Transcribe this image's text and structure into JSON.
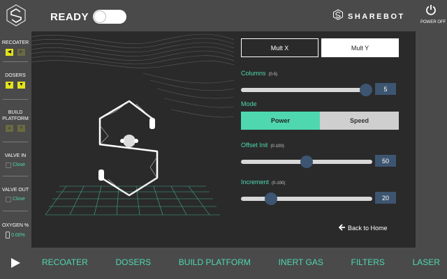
{
  "header": {
    "status_label": "READY",
    "brand_name": "SHAREBOT",
    "power_label": "POWER OFF"
  },
  "sidebar": {
    "recoater": {
      "label": "RECOATER",
      "btn_left": "◀",
      "btn_right": "▶"
    },
    "dosers": {
      "label": "DOSERS",
      "btn_1": "▼",
      "btn_2": "▼"
    },
    "build_platform": {
      "label_line1": "BUILD",
      "label_line2": "PLATFORM",
      "btn_up": "▲",
      "btn_down": "▼"
    },
    "valve_in": {
      "label": "VALVE IN",
      "state": "Close"
    },
    "valve_out": {
      "label": "VALVE OUT",
      "state": "Close"
    },
    "oxygen": {
      "label": "OXYGEN %",
      "value": "0.00%"
    }
  },
  "controls": {
    "mult_x_label": "Mult X",
    "mult_y_label": "Mult Y",
    "columns": {
      "label": "Columns",
      "range": "(0-5)",
      "value": "5",
      "fraction": 1.0
    },
    "mode": {
      "label": "Mode",
      "power_label": "Power",
      "speed_label": "Speed"
    },
    "offset_init": {
      "label": "Offset Init",
      "range": "(0-100)",
      "value": "50",
      "fraction": 0.5
    },
    "increment": {
      "label": "Increment",
      "range": "(0-100)",
      "value": "20",
      "fraction": 0.2
    },
    "back_label": "Back to Home"
  },
  "bottom_nav": {
    "items": [
      "RECOATER",
      "DOSERS",
      "BUILD PLATFORM",
      "INERT GAS",
      "FILTERS",
      "LASER"
    ]
  },
  "colors": {
    "accent": "#4fd8b0",
    "highlight": "#e3e31c",
    "value_box": "#3d5570",
    "panel": "#2a2a2a",
    "background": "#4a4a4a"
  }
}
